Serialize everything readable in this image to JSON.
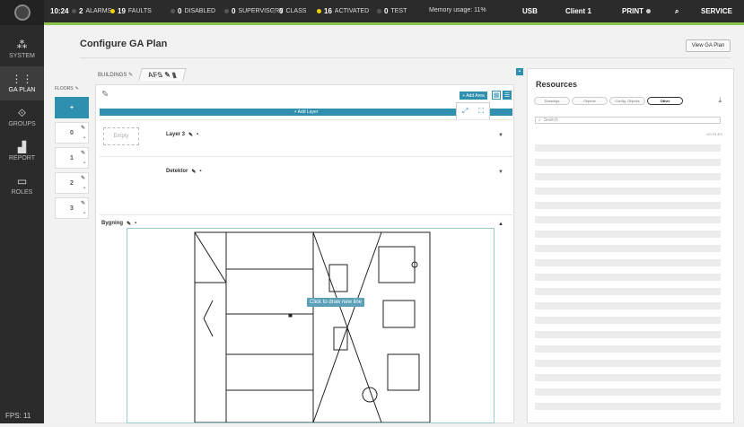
{
  "topbar": {
    "time": "10:24",
    "alarms": {
      "count": "2",
      "label": "ALARMS"
    },
    "faults": {
      "count": "19",
      "label": "FAULTS"
    },
    "disabled": {
      "count": "0",
      "label": "DISABLED"
    },
    "supervisory": {
      "count": "0",
      "label": "SUPERVISORY"
    },
    "class": {
      "count": "0",
      "label": "CLASS"
    },
    "activated": {
      "count": "16",
      "label": "ACTIVATED"
    },
    "test": {
      "count": "0",
      "label": "TEST"
    },
    "memory": "Memory usage: 11%",
    "usb": "USB",
    "client": "Client 1",
    "print": "PRINT",
    "service": "SERVICE"
  },
  "sidebar": {
    "items": [
      {
        "label": "SYSTEM",
        "icon": "system-icon"
      },
      {
        "label": "GA PLAN",
        "icon": "ga-plan-icon"
      },
      {
        "label": "GROUPS",
        "icon": "groups-icon"
      },
      {
        "label": "REPORT",
        "icon": "report-icon"
      },
      {
        "label": "ROLES",
        "icon": "roles-icon"
      }
    ],
    "fps": "FPS: 11"
  },
  "page": {
    "title": "Configure GA Plan",
    "view_button": "View GA Plan"
  },
  "breadcrumb": {
    "buildings": "BUILDINGS",
    "current": "AFS"
  },
  "floors": {
    "header": "FLOORS",
    "add": "+",
    "items": [
      "0",
      "1",
      "2",
      "3"
    ]
  },
  "editor": {
    "add_area": "+ Add Area",
    "add_layer": "+ Add Layer",
    "layers": [
      {
        "thumb": "Empty",
        "name": "Layer 3"
      },
      {
        "thumb": "",
        "name": "Detektor"
      }
    ],
    "plan_layer": "Bygning",
    "tooltip": "Click to draw new line"
  },
  "resources": {
    "title": "Resources",
    "tabs": [
      "Drawings",
      "Objects",
      "Config. Objects",
      "Other"
    ],
    "active_tab": "Other",
    "search_placeholder": "Search",
    "count": "0/0 FILES"
  },
  "colors": {
    "accent": "#2f8fae",
    "status_bar": "#8bc34a",
    "dark": "#2b2b2b"
  }
}
